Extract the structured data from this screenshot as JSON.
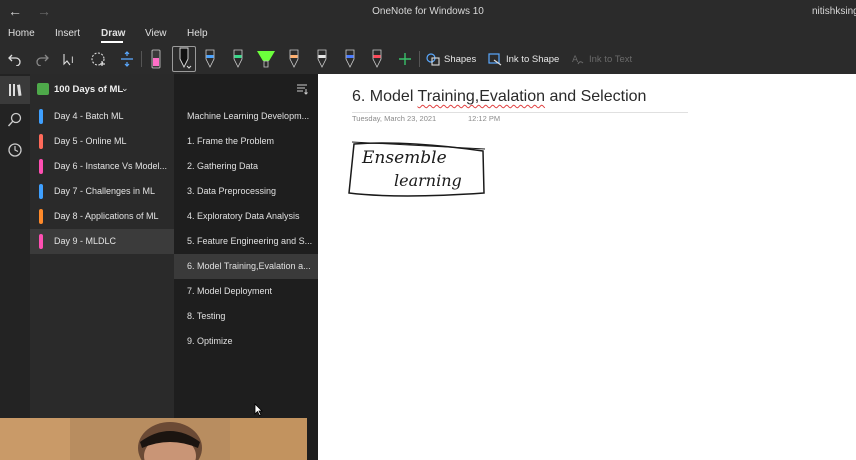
{
  "window": {
    "title": "OneNote for Windows 10",
    "user": "nitishksing"
  },
  "ribbon": {
    "tabs": [
      {
        "label": "Home"
      },
      {
        "label": "Insert"
      },
      {
        "label": "Draw"
      },
      {
        "label": "View"
      },
      {
        "label": "Help"
      }
    ],
    "active_tab": "Draw"
  },
  "toolbar": {
    "shapes_label": "Shapes",
    "ink_to_shape_label": "Ink to Shape",
    "ink_to_text_label": "Ink to Text",
    "pens": [
      {
        "name": "highlighter-pink",
        "color": "#ff6fc7"
      },
      {
        "name": "pen-black",
        "color": "#111111"
      },
      {
        "name": "pen-blue",
        "color": "#4aa3ff"
      },
      {
        "name": "pen-green",
        "color": "#39d98a"
      },
      {
        "name": "highlighter-green",
        "color": "#6cff3c"
      },
      {
        "name": "pen-orange",
        "color": "#ffb070"
      },
      {
        "name": "pen-black-2",
        "color": "#1a1a1a"
      },
      {
        "name": "pen-blue-2",
        "color": "#4a7bff"
      },
      {
        "name": "pen-red",
        "color": "#ff4a5a"
      }
    ]
  },
  "notebook": {
    "name": "100 Days of ML",
    "color": "#4ea94a"
  },
  "sections": [
    {
      "label": "Day 4 - Batch ML",
      "color": "#3fa0ff"
    },
    {
      "label": "Day 5 - Online ML",
      "color": "#ff6a5a"
    },
    {
      "label": "Day 6 - Instance Vs Model...",
      "color": "#ff4fb2"
    },
    {
      "label": "Day 7 - Challenges in ML",
      "color": "#3fa0ff"
    },
    {
      "label": "Day 8 - Applications of ML",
      "color": "#ff8a2a"
    },
    {
      "label": "Day 9 - MLDLC",
      "color": "#ff4fb2"
    }
  ],
  "active_section_index": 5,
  "pages": [
    {
      "label": "Machine Learning Developm..."
    },
    {
      "label": "1. Frame the Problem"
    },
    {
      "label": "2. Gathering Data"
    },
    {
      "label": "3. Data Preprocessing"
    },
    {
      "label": "4. Exploratory Data Analysis"
    },
    {
      "label": "5. Feature Engineering and S..."
    },
    {
      "label": "6. Model Training,Evalation a..."
    },
    {
      "label": "7. Model Deployment"
    },
    {
      "label": "8. Testing"
    },
    {
      "label": "9. Optimize"
    }
  ],
  "active_page_index": 6,
  "note": {
    "title_prefix": "6. Model ",
    "title_misspelled": "Training,Evalation",
    "title_suffix": " and Selection",
    "date": "Tuesday, March 23, 2021",
    "time": "12:12 PM",
    "handwriting": [
      "Ensemble",
      "learning"
    ]
  }
}
